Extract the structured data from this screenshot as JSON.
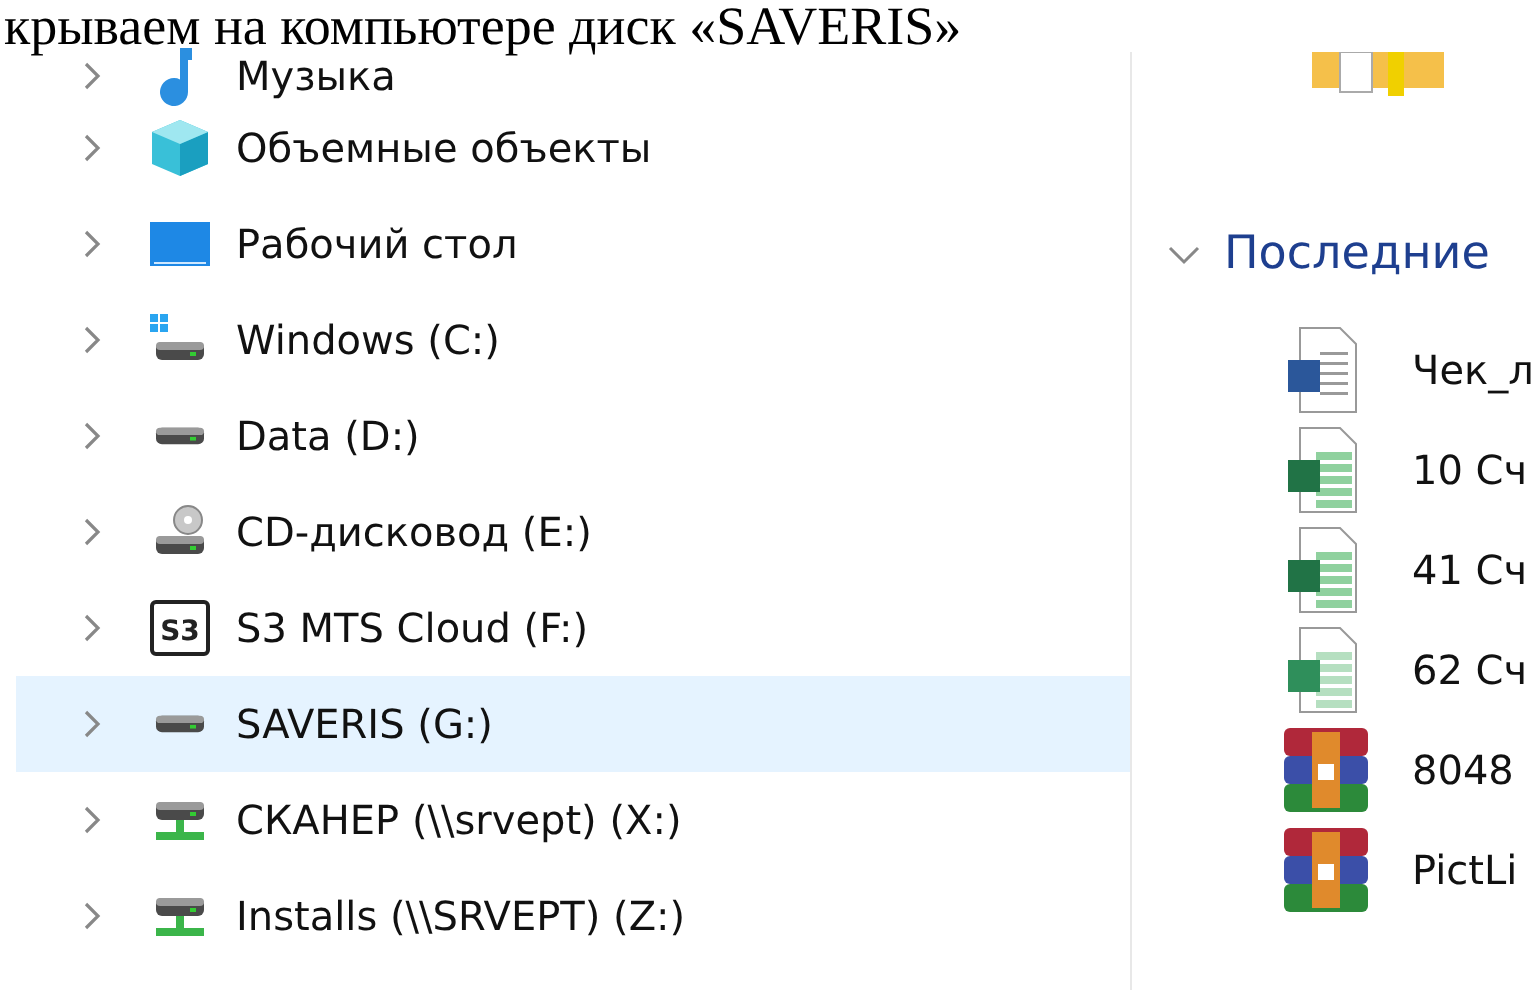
{
  "caption": "крываем на компьютере диск «SAVERIS»",
  "navigation": {
    "items": [
      {
        "label": "Музыка",
        "kind": "music",
        "selected": false
      },
      {
        "label": "Объемные объекты",
        "kind": "cube",
        "selected": false
      },
      {
        "label": "Рабочий стол",
        "kind": "desktop",
        "selected": false
      },
      {
        "label": "Windows (C:)",
        "kind": "system-drive",
        "selected": false
      },
      {
        "label": "Data (D:)",
        "kind": "drive",
        "selected": false
      },
      {
        "label": "CD-дисковод (E:)",
        "kind": "cd-drive",
        "selected": false
      },
      {
        "label": "S3 MTS Cloud (F:)",
        "kind": "badge-drive",
        "icon_text": "S3",
        "selected": false
      },
      {
        "label": "SAVERIS (G:)",
        "kind": "drive",
        "selected": true
      },
      {
        "label": "СКАНЕР (\\\\srvept) (X:)",
        "kind": "network-drive",
        "selected": false
      },
      {
        "label": "Installs (\\\\SRVEPT) (Z:)",
        "kind": "network-drive",
        "selected": false
      }
    ]
  },
  "recent": {
    "title": "Последние",
    "expanded": true,
    "files": [
      {
        "name": "Чек_л",
        "kind": "word"
      },
      {
        "name": "10 Сч",
        "kind": "excel"
      },
      {
        "name": "41 Сч",
        "kind": "excel"
      },
      {
        "name": "62 Сч",
        "kind": "excel-old"
      },
      {
        "name": "8048",
        "kind": "archive"
      },
      {
        "name": "PictLi",
        "kind": "archive"
      }
    ]
  }
}
